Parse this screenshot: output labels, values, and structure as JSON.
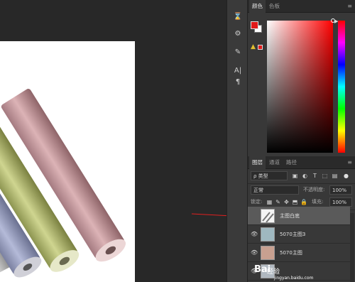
{
  "tools": {
    "items": [
      {
        "name": "history-brush-icon",
        "glyph": "⌛"
      },
      {
        "name": "adjust-icon",
        "glyph": "⚙"
      },
      {
        "name": "brush-preset-icon",
        "glyph": "✎"
      },
      {
        "name": "character-icon",
        "glyph": "A|"
      },
      {
        "name": "paragraph-icon",
        "glyph": "¶"
      }
    ]
  },
  "color_panel": {
    "tabs": [
      "颜色",
      "色板"
    ],
    "menu_glyph": "≡",
    "fg_color": "#e01a1a",
    "bg_color": "#ffffff"
  },
  "layers_panel": {
    "tabs": [
      "图层",
      "通道",
      "路径"
    ],
    "menu_glyph": "≡",
    "filter_kind": "ρ 类型",
    "blend_mode": "正常",
    "opacity_label": "不透明度:",
    "opacity_value": "100%",
    "lock_label": "锁定:",
    "fill_label": "填充:",
    "fill_value": "100%",
    "layers": [
      {
        "name": "主图白底",
        "visible": false,
        "selected": true
      },
      {
        "name": "5070主图3",
        "visible": true,
        "selected": false
      },
      {
        "name": "5070主图",
        "visible": true,
        "selected": false
      },
      {
        "name": "",
        "visible": true,
        "selected": false
      }
    ]
  },
  "watermark": {
    "logo": "Bai",
    "text": "经验",
    "sub": "jingyan.baidu.com"
  },
  "accent": {
    "arrow_color": "#e02020"
  }
}
